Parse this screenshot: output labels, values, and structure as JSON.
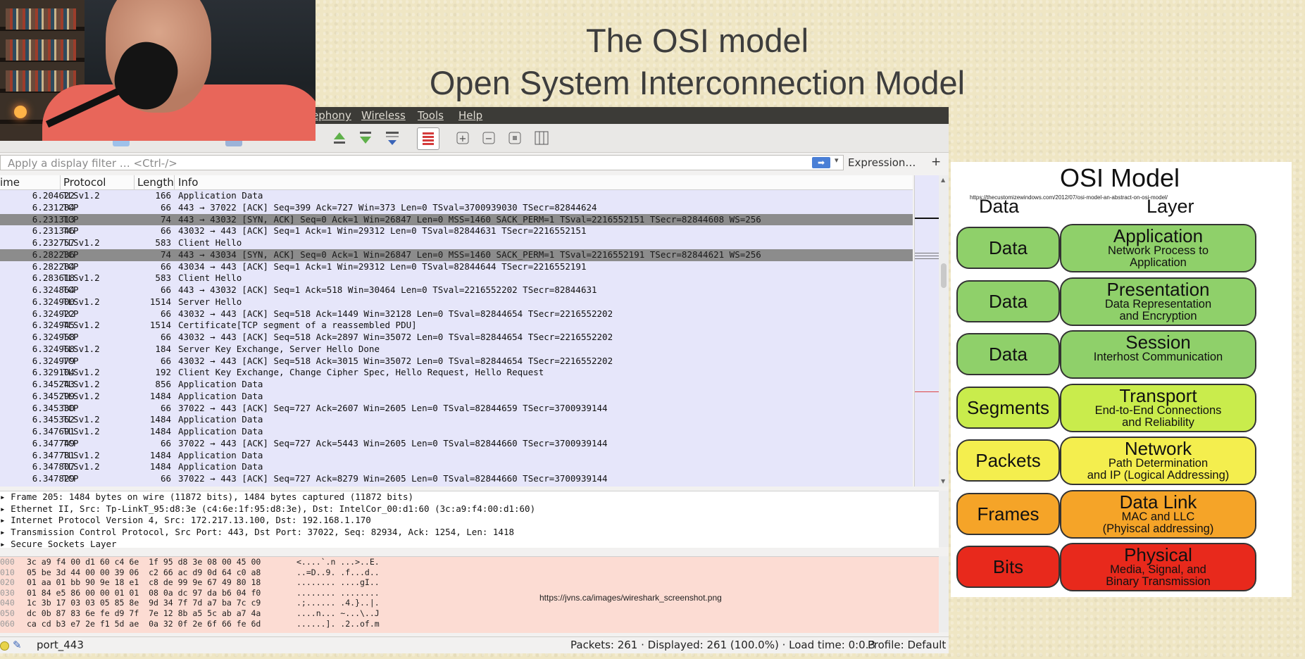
{
  "slide": {
    "title_line1": "The OSI model",
    "title_line2": "Open System Interconnection Model"
  },
  "wireshark": {
    "menu": [
      "ephony",
      "Wireless",
      "Tools",
      "Help"
    ],
    "filter_placeholder": "Apply a display filter … <Ctrl-/>",
    "expression_label": "Expression…",
    "add_label": "+",
    "columns": [
      "ime",
      "Protocol",
      "Length",
      "Info"
    ],
    "packets": [
      {
        "time": "6.204622",
        "protocol": "TLSv1.2",
        "length": "166",
        "info": "Application Data"
      },
      {
        "time": "6.231284",
        "protocol": "TCP",
        "length": "66",
        "info": "443 → 37022 [ACK] Seq=399 Ack=727 Win=373 Len=0 TSval=3700939030 TSecr=82844624"
      },
      {
        "time": "6.231313",
        "protocol": "TCP",
        "length": "74",
        "info": "443 → 43032 [SYN, ACK] Seq=0 Ack=1 Win=26847 Len=0 MSS=1460 SACK_PERM=1 TSval=2216552151 TSecr=82844608 WS=256"
      },
      {
        "time": "6.231346",
        "protocol": "TCP",
        "length": "66",
        "info": "43032 → 443 [ACK] Seq=1 Ack=1 Win=29312 Len=0 TSval=82844631 TSecr=2216552151"
      },
      {
        "time": "6.232757",
        "protocol": "TLSv1.2",
        "length": "583",
        "info": "Client Hello"
      },
      {
        "time": "6.282236",
        "protocol": "TCP",
        "length": "74",
        "info": "443 → 43034 [SYN, ACK] Seq=0 Ack=1 Win=26847 Len=0 MSS=1460 SACK_PERM=1 TSval=2216552191 TSecr=82844621 WS=256"
      },
      {
        "time": "6.282284",
        "protocol": "TCP",
        "length": "66",
        "info": "43034 → 443 [ACK] Seq=1 Ack=1 Win=29312 Len=0 TSval=82844644 TSecr=2216552191"
      },
      {
        "time": "6.283618",
        "protocol": "TLSv1.2",
        "length": "583",
        "info": "Client Hello"
      },
      {
        "time": "6.324864",
        "protocol": "TCP",
        "length": "66",
        "info": "443 → 43032 [ACK] Seq=1 Ack=518 Win=30464 Len=0 TSval=2216552202 TSecr=82844631"
      },
      {
        "time": "6.324900",
        "protocol": "TLSv1.2",
        "length": "1514",
        "info": "Server Hello"
      },
      {
        "time": "6.324922",
        "protocol": "TCP",
        "length": "66",
        "info": "43032 → 443 [ACK] Seq=518 Ack=1449 Win=32128 Len=0 TSval=82844654 TSecr=2216552202"
      },
      {
        "time": "6.324945",
        "protocol": "TLSv1.2",
        "length": "1514",
        "info": "Certificate[TCP segment of a reassembled PDU]"
      },
      {
        "time": "6.324958",
        "protocol": "TCP",
        "length": "66",
        "info": "43032 → 443 [ACK] Seq=518 Ack=2897 Win=35072 Len=0 TSval=82844654 TSecr=2216552202"
      },
      {
        "time": "6.324968",
        "protocol": "TLSv1.2",
        "length": "184",
        "info": "Server Key Exchange, Server Hello Done"
      },
      {
        "time": "6.324979",
        "protocol": "TCP",
        "length": "66",
        "info": "43032 → 443 [ACK] Seq=518 Ack=3015 Win=35072 Len=0 TSval=82844654 TSecr=2216552202"
      },
      {
        "time": "6.329104",
        "protocol": "TLSv1.2",
        "length": "192",
        "info": "Client Key Exchange, Change Cipher Spec, Hello Request, Hello Request"
      },
      {
        "time": "6.345243",
        "protocol": "TLSv1.2",
        "length": "856",
        "info": "Application Data"
      },
      {
        "time": "6.345299",
        "protocol": "TLSv1.2",
        "length": "1484",
        "info": "Application Data"
      },
      {
        "time": "6.345330",
        "protocol": "TCP",
        "length": "66",
        "info": "37022 → 443 [ACK] Seq=727 Ack=2607 Win=2605 Len=0 TSval=82844659 TSecr=3700939144"
      },
      {
        "time": "6.345362",
        "protocol": "TLSv1.2",
        "length": "1484",
        "info": "Application Data"
      },
      {
        "time": "6.347691",
        "protocol": "TLSv1.2",
        "length": "1484",
        "info": "Application Data"
      },
      {
        "time": "6.347749",
        "protocol": "TCP",
        "length": "66",
        "info": "37022 → 443 [ACK] Seq=727 Ack=5443 Win=2605 Len=0 TSval=82844660 TSecr=3700939144"
      },
      {
        "time": "6.347781",
        "protocol": "TLSv1.2",
        "length": "1484",
        "info": "Application Data"
      },
      {
        "time": "6.347807",
        "protocol": "TLSv1.2",
        "length": "1484",
        "info": "Application Data"
      },
      {
        "time": "6.347829",
        "protocol": "TCP",
        "length": "66",
        "info": "37022 → 443 [ACK] Seq=727 Ack=8279 Win=2605 Len=0 TSval=82844660 TSecr=3700939144"
      }
    ],
    "selected_rows": [
      2,
      5
    ],
    "details": [
      "Frame 205: 1484 bytes on wire (11872 bits), 1484 bytes captured (11872 bits)",
      "Ethernet II, Src: Tp-LinkT_95:d8:3e (c4:6e:1f:95:d8:3e), Dst: IntelCor_00:d1:60 (3c:a9:f4:00:d1:60)",
      "Internet Protocol Version 4, Src: 172.217.13.100, Dst: 192.168.1.170",
      "Transmission Control Protocol, Src Port: 443, Dst Port: 37022, Seq: 82934, Ack: 1254, Len: 1418",
      "Secure Sockets Layer"
    ],
    "bytes": [
      {
        "offset": "000",
        "hex": "3c a9 f4 00 d1 60 c4 6e  1f 95 d8 3e 08 00 45 00",
        "ascii": "<....`.n ...>..E."
      },
      {
        "offset": "010",
        "hex": "05 be 3d 44 00 00 39 06  c2 66 ac d9 0d 64 c0 a8",
        "ascii": "..=D..9. .f...d.."
      },
      {
        "offset": "020",
        "hex": "01 aa 01 bb 90 9e 18 e1  c8 de 99 9e 67 49 80 18",
        "ascii": "........ ....gI.."
      },
      {
        "offset": "030",
        "hex": "01 84 e5 86 00 00 01 01  08 0a dc 97 da b6 04 f0",
        "ascii": "........ ........"
      },
      {
        "offset": "040",
        "hex": "1c 3b 17 03 03 05 85 8e  9d 34 7f 7d a7 ba 7c c9",
        "ascii": ".;...... .4.}..|."
      },
      {
        "offset": "050",
        "hex": "dc 0b 87 83 6e fe d9 7f  7e 12 8b a5 5c ab a7 4a",
        "ascii": "....n... ~...\\..J"
      },
      {
        "offset": "060",
        "hex": "ca cd b3 e7 2e f1 5d ae  0a 32 0f 2e 6f 66 fe 6d",
        "ascii": "......]. .2..of.m"
      }
    ],
    "bytes_url": "https://jvns.ca/images/wireshark_screenshot.png",
    "status": {
      "profile_name": "port_443",
      "packets_info": "Packets: 261 · Displayed: 261 (100.0%) · Load time: 0:0.3",
      "profile": "Profile: Default"
    }
  },
  "osi": {
    "title": "OSI Model",
    "url": "https://thecustomizewindows.com/2012/07/osi-model-an-abstract-on-osi-model/",
    "col_data": "Data",
    "col_layer": "Layer",
    "layers": [
      {
        "data": "Data",
        "name": "Application",
        "desc1": "Network Process to",
        "desc2": "Application",
        "color": "#8fd06a"
      },
      {
        "data": "Data",
        "name": "Presentation",
        "desc1": "Data Representation",
        "desc2": "and Encryption",
        "color": "#8fd06a"
      },
      {
        "data": "Data",
        "name": "Session",
        "desc1": "Interhost Communication",
        "desc2": "",
        "color": "#8fd06a"
      },
      {
        "data": "Segments",
        "name": "Transport",
        "desc1": "End-to-End Connections",
        "desc2": "and Reliability",
        "color": "#c9ec4c"
      },
      {
        "data": "Packets",
        "name": "Network",
        "desc1": "Path Determination",
        "desc2": "and IP (Logical Addressing)",
        "color": "#f4ee4e"
      },
      {
        "data": "Frames",
        "name": "Data Link",
        "desc1": "MAC and LLC",
        "desc2": "(Phyiscal addressing)",
        "color": "#f5a428"
      },
      {
        "data": "Bits",
        "name": "Physical",
        "desc1": "Media, Signal, and",
        "desc2": "Binary Transmission",
        "color": "#e8291c"
      }
    ]
  }
}
